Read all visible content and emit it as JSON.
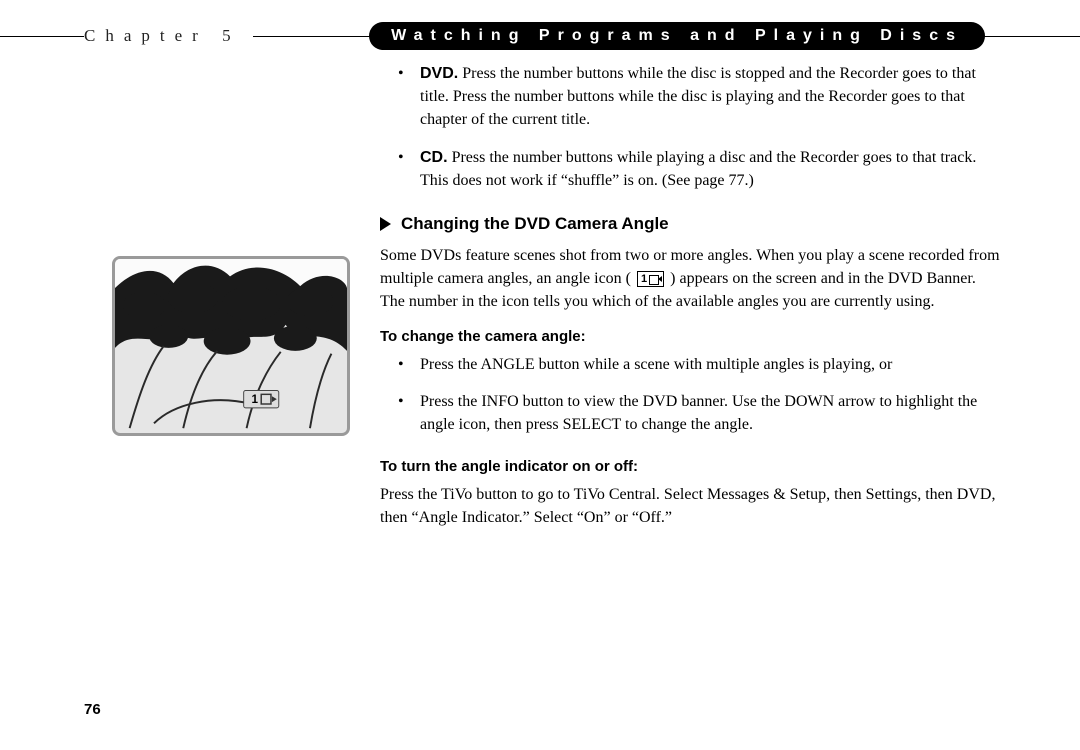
{
  "header": {
    "chapter_label": "Chapter 5",
    "chapter_title": "Watching Programs and Playing Discs"
  },
  "top_bullets": [
    {
      "bold": "DVD.",
      "text": " Press the number buttons while the disc is stopped and the Recorder goes to that title. Press the number buttons while the disc is playing and the Recorder goes to that chapter of the current title."
    },
    {
      "bold": "CD.",
      "text": " Press the number buttons while playing a disc and the Recorder goes to that track. This does not work if “shuffle” is on. (See page 77.)"
    }
  ],
  "section": {
    "heading": "Changing the DVD Camera Angle",
    "intro_pre": "Some DVDs feature scenes shot from two or more angles. When you play a scene recorded from multiple camera angles, an angle icon (",
    "intro_post": ") appears on the screen and in the DVD Banner. The number in the icon tells you which of the available angles you are currently using.",
    "angle_icon_number": "1",
    "sub1_heading": "To change the camera angle:",
    "sub1_bullets": [
      "Press the ANGLE button while a scene with multiple angles is playing, or",
      "Press the INFO button to view the DVD banner. Use the DOWN arrow to highlight the angle icon, then press SELECT to change the angle."
    ],
    "sub2_heading": "To turn the angle indicator on or off:",
    "sub2_body": "Press the TiVo button to go to TiVo Central. Select Messages & Setup, then Settings, then DVD, then “Angle Indicator.” Select “On” or “Off.”"
  },
  "figure": {
    "angle_number": "1"
  },
  "page_number": "76"
}
